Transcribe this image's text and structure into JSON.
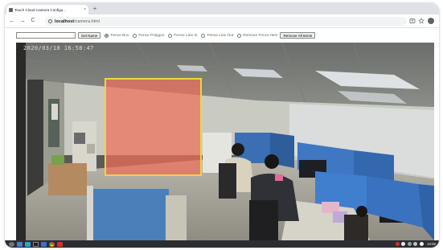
{
  "browser": {
    "tab_title": "Touch Cloud Camera Configu...",
    "tab_close": "×",
    "new_tab": "+",
    "url_host": "localhost",
    "url_path": "/camera.html",
    "nav": {
      "back": "←",
      "forward": "→",
      "reload": "C"
    }
  },
  "controls": {
    "name_value": "",
    "set_name_label": "Set Name",
    "modes": [
      {
        "label": "Fence Box",
        "selected": true
      },
      {
        "label": "Fence Polygon",
        "selected": false
      },
      {
        "label": "Fence Line In",
        "selected": false
      },
      {
        "label": "Fence Line Out",
        "selected": false
      },
      {
        "label": "Remove Fence Item",
        "selected": false
      }
    ],
    "remove_all_label": "Remove All Items"
  },
  "camera": {
    "timestamp": "2020/03/18 16:58:47",
    "fence_color": "#ee6e5a",
    "fence_border": "#f2d43a"
  },
  "taskbar": {
    "apps": [
      "launcher-icon",
      "files-icon",
      "bird-app-icon",
      "terminal-icon",
      "folder-icon",
      "chrome-icon",
      "record-icon"
    ],
    "time": "16:58"
  }
}
